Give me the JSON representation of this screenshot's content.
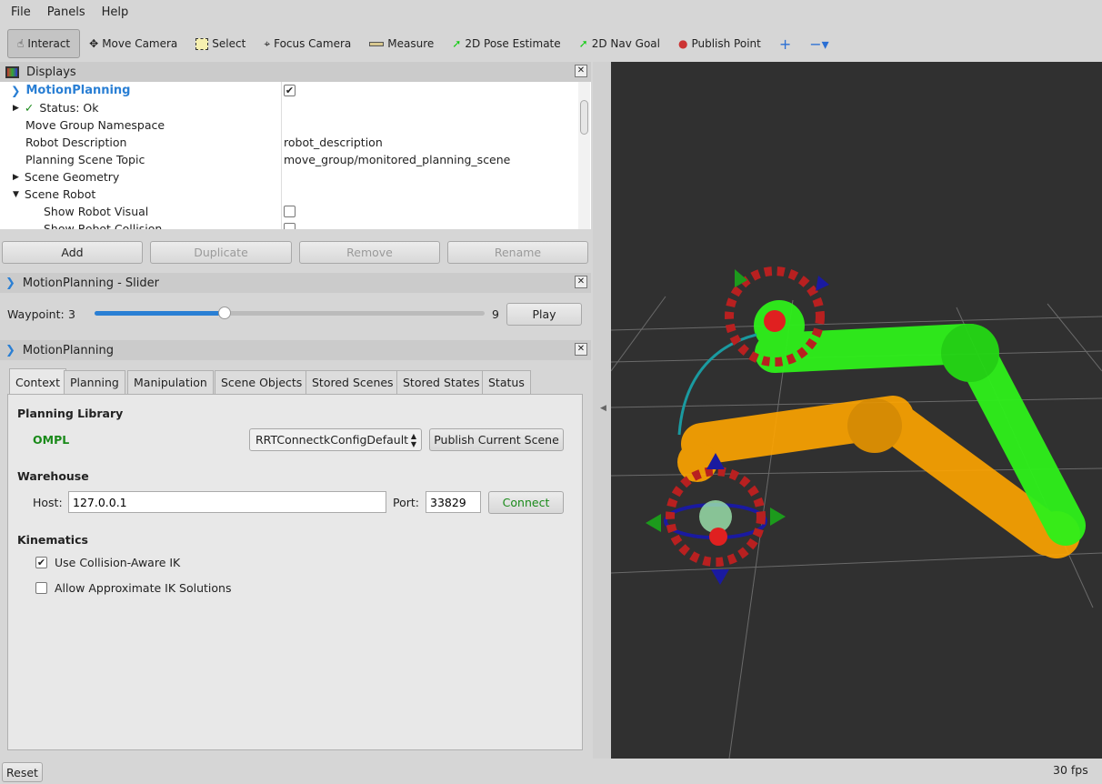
{
  "menu": [
    "File",
    "Panels",
    "Help"
  ],
  "toolbar": [
    {
      "label": "Interact",
      "icon": "hand-icon"
    },
    {
      "label": "Move Camera",
      "icon": "move-camera-icon"
    },
    {
      "label": "Select",
      "icon": "select-icon"
    },
    {
      "label": "Focus Camera",
      "icon": "focus-camera-icon"
    },
    {
      "label": "Measure",
      "icon": "ruler-icon"
    },
    {
      "label": "2D Pose Estimate",
      "icon": "green-arrow-icon"
    },
    {
      "label": "2D Nav Goal",
      "icon": "green-arrow-icon"
    },
    {
      "label": "Publish Point",
      "icon": "map-pin-icon"
    }
  ],
  "displays": {
    "title": "Displays",
    "rows": [
      {
        "label": "MotionPlanning",
        "value": "",
        "check": true
      },
      {
        "label": "Status: Ok",
        "value": ""
      },
      {
        "label": "Move Group Namespace",
        "value": ""
      },
      {
        "label": "Robot Description",
        "value": "robot_description"
      },
      {
        "label": "Planning Scene Topic",
        "value": "move_group/monitored_planning_scene"
      },
      {
        "label": "Scene Geometry",
        "value": ""
      },
      {
        "label": "Scene Robot",
        "value": ""
      },
      {
        "label": "Show Robot Visual",
        "value": "",
        "check": false
      },
      {
        "label": "Show Robot Collision",
        "value": "",
        "check": false
      }
    ],
    "buttons": [
      "Add",
      "Duplicate",
      "Remove",
      "Rename"
    ]
  },
  "slider": {
    "title": "MotionPlanning - Slider",
    "label": "Waypoint:",
    "value": "3",
    "max": "9",
    "fraction": 0.333,
    "play": "Play"
  },
  "mp": {
    "title": "MotionPlanning",
    "tabs": [
      "Context",
      "Planning",
      "Manipulation",
      "Scene Objects",
      "Stored Scenes",
      "Stored States",
      "Status"
    ],
    "planning_library": "Planning Library",
    "library": "OMPL",
    "planner": "RRTConnectkConfigDefault",
    "publish": "Publish Current Scene",
    "warehouse": "Warehouse",
    "host_label": "Host:",
    "host": "127.0.0.1",
    "port_label": "Port:",
    "port": "33829",
    "connect": "Connect",
    "kinematics": "Kinematics",
    "ik1": "Use Collision-Aware IK",
    "ik2": "Allow Approximate IK Solutions"
  },
  "status": {
    "reset": "Reset",
    "fps": "30 fps"
  },
  "colors": {
    "accent": "#2a7fd4",
    "ok": "#1a8a1a",
    "robot_goal": "#2ef01a",
    "robot_start": "#ffa500",
    "viewport": "#303030"
  }
}
